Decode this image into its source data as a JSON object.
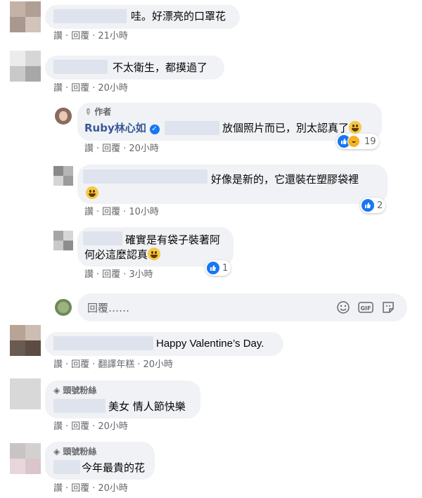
{
  "meta_labels": {
    "like": "讚",
    "reply": "回覆",
    "translate": "翻譯年糕"
  },
  "comments": [
    {
      "text": "哇。好漂亮的口罩花",
      "time": "21小時"
    },
    {
      "text": "不太衛生，都摸過了",
      "time": "20小時"
    },
    {
      "author_tag": "作者",
      "author_name": "Ruby林心如",
      "text": "放個照片而已，別太認真了",
      "time": "20小時",
      "reactions": "19"
    },
    {
      "text": "好像是新的，它還裝在塑膠袋裡",
      "time": "10小時",
      "reactions": "2"
    },
    {
      "text_line1": "確實是有袋子裝著阿",
      "text_line2": "何必這麼認真",
      "time": "3小時",
      "reactions": "1"
    },
    {
      "text": "Happy Valentine’s Day.",
      "time": "20小時"
    },
    {
      "badge": "頭號粉絲",
      "text": "美女 情人節快樂",
      "time": "20小時"
    },
    {
      "badge": "頭號粉絲",
      "text": "今年最貴的花",
      "time": "20小時"
    }
  ],
  "reply_box": {
    "placeholder": "回覆……"
  },
  "colors": {
    "accent": "#1877f2",
    "bubble": "#f0f2f5",
    "meta": "#65676b",
    "author": "#385898"
  }
}
